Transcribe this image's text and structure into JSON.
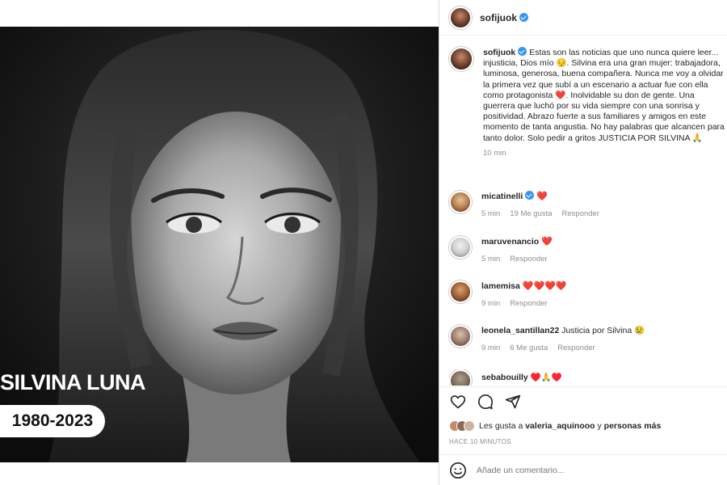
{
  "photo": {
    "name": "SILVINA LUNA",
    "years": "1980-2023"
  },
  "header": {
    "username": "sofijuok"
  },
  "post": {
    "author": "sofijuok",
    "caption": "Estas son las noticias que uno nunca quiere leer... injusticia, Dios mío 😔. Silvina era una gran mujer: trabajadora, luminosa, generosa, buena compañera. Nunca me voy a olvidar la primera vez que subí a un escenario a actuar fue con ella como protagonista ❤️. Inolvidable su don de gente. Una guerrera que luchó por su vida siempre con una sonrisa y positividad. Abrazo fuerte a sus familiares y amigos en este momento de tanta angustia. No hay palabras que alcancen para tanto dolor. Solo pedir a gritos JUSTICIA POR SILVINA 🙏",
    "time": "10 min"
  },
  "comments": [
    {
      "user": "micatinelli",
      "text": "❤️",
      "time": "5 min",
      "likes": "19 Me gusta",
      "reply": "Responder"
    },
    {
      "user": "maruvenancio",
      "text": "❤️",
      "time": "5 min",
      "likes": "",
      "reply": "Responder"
    },
    {
      "user": "lamemisa",
      "text": "❤️❤️❤️❤️",
      "time": "9 min",
      "likes": "",
      "reply": "Responder"
    },
    {
      "user": "leonela_santillan22",
      "text": "Justicia por Silvina 😢",
      "time": "9 min",
      "likes": "6 Me gusta",
      "reply": "Responder"
    },
    {
      "user": "sebabouilly",
      "text": "♥️🙏♥️",
      "time": "",
      "likes": "",
      "reply": ""
    }
  ],
  "likes": {
    "prefix": "Les gusta a",
    "user": "valeria_aquinooo",
    "connector": "y",
    "suffix": "personas más"
  },
  "posted_ago": "HACE 10 MINUTOS",
  "comment_input": {
    "placeholder": "Añade un comentario..."
  },
  "icons": [
    "verified-badge-icon",
    "heart-outline-icon",
    "comment-bubble-icon",
    "share-send-icon",
    "emoji-smile-icon"
  ],
  "colors": {
    "verified": "#3897f0",
    "heart": "#ed1c40",
    "muted_text": "#8e8e8e",
    "text": "#262626"
  }
}
